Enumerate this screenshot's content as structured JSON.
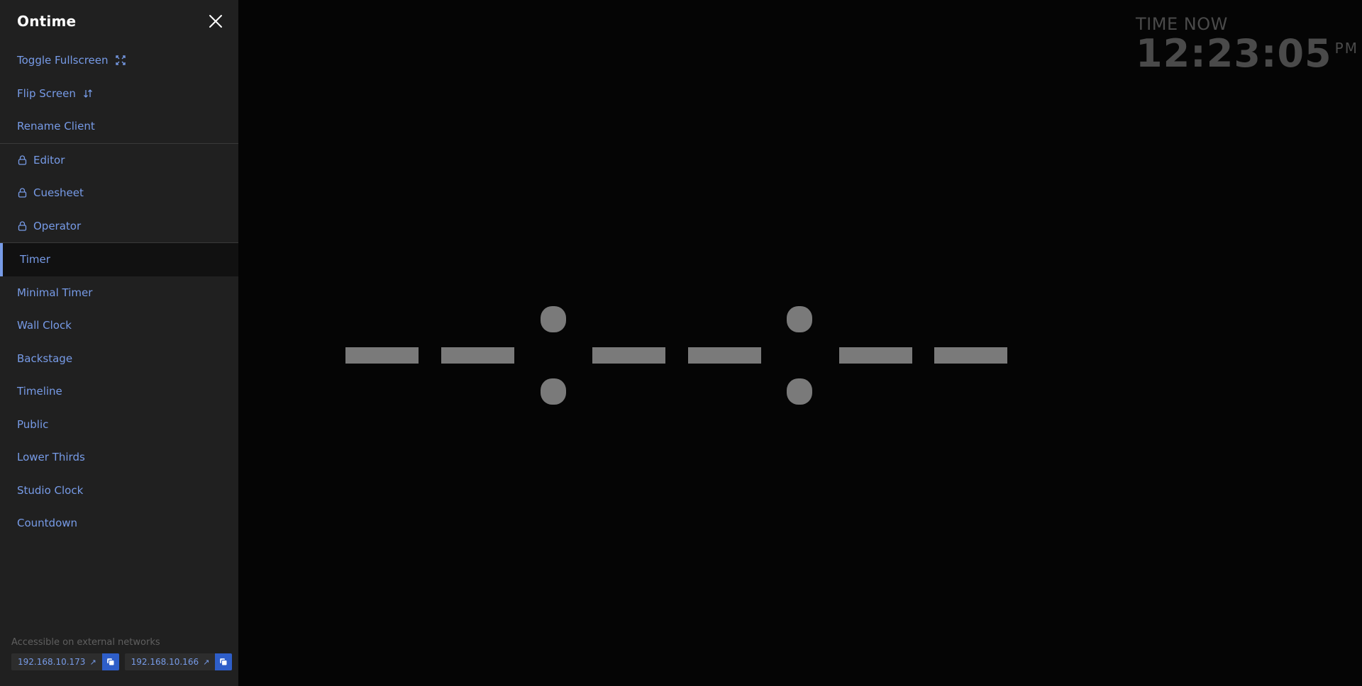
{
  "app": {
    "title": "Ontime"
  },
  "sidebar": {
    "title": "Ontime",
    "close_icon": "close-icon",
    "actions": [
      {
        "label": "Toggle Fullscreen",
        "icon": "fullscreen-icon"
      },
      {
        "label": "Flip Screen",
        "icon": "flip-icon"
      },
      {
        "label": "Rename Client"
      }
    ],
    "locked_views": [
      {
        "label": "Editor",
        "icon": "lock-icon"
      },
      {
        "label": "Cuesheet",
        "icon": "lock-icon"
      },
      {
        "label": "Operator",
        "icon": "lock-icon"
      }
    ],
    "views": [
      {
        "label": "Timer",
        "active": true
      },
      {
        "label": "Minimal Timer"
      },
      {
        "label": "Wall Clock"
      },
      {
        "label": "Backstage"
      },
      {
        "label": "Timeline"
      },
      {
        "label": "Public"
      },
      {
        "label": "Lower Thirds"
      },
      {
        "label": "Studio Clock"
      },
      {
        "label": "Countdown"
      }
    ],
    "footer": {
      "label": "Accessible on external networks",
      "addresses": [
        {
          "ip": "192.168.10.173",
          "link_icon": "external-link-icon",
          "copy_icon": "copy-icon"
        },
        {
          "ip": "192.168.10.166",
          "link_icon": "external-link-icon",
          "copy_icon": "copy-icon"
        }
      ]
    }
  },
  "clock": {
    "label": "TIME NOW",
    "time": "12:23:05",
    "ampm": "PM"
  },
  "timer": {
    "display": "--:--:--"
  },
  "colors": {
    "accent": "#779be7",
    "sidebar_bg": "#202020",
    "main_bg": "#050505",
    "timer_fg": "#7a7a7a",
    "clock_fg": "#4a4a4a",
    "copy_button": "#2e5ec9"
  }
}
